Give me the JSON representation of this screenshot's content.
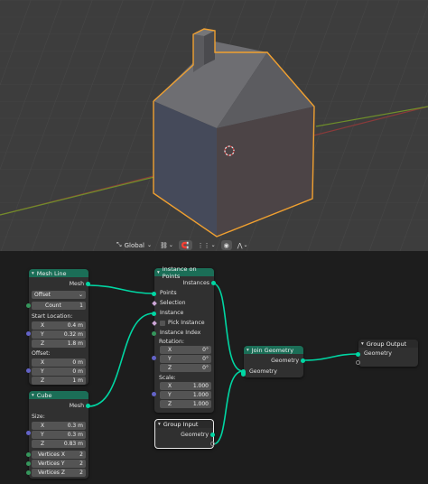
{
  "viewport": {
    "header": {
      "orientation": "Global"
    }
  },
  "nodes": {
    "mesh_line": {
      "title": "Mesh Line",
      "mesh_out": "Mesh",
      "mode": "Offset",
      "count_label": "Count",
      "count_value": "1",
      "start_label": "Start Location:",
      "start": [
        {
          "axis": "X",
          "value": "0.4 m"
        },
        {
          "axis": "Y",
          "value": "0.32 m"
        },
        {
          "axis": "Z",
          "value": "1.8 m"
        }
      ],
      "offset_label": "Offset:",
      "offset": [
        {
          "axis": "X",
          "value": "0 m"
        },
        {
          "axis": "Y",
          "value": "0 m"
        },
        {
          "axis": "Z",
          "value": "1 m"
        }
      ]
    },
    "cube": {
      "title": "Cube",
      "mesh_out": "Mesh",
      "size_label": "Size:",
      "size": [
        {
          "axis": "X",
          "value": "0.3 m"
        },
        {
          "axis": "Y",
          "value": "0.3 m"
        },
        {
          "axis": "Z",
          "value": "0.83 m"
        }
      ],
      "vertices": [
        {
          "label": "Vertices X",
          "value": "2"
        },
        {
          "label": "Vertices Y",
          "value": "2"
        },
        {
          "label": "Vertices Z",
          "value": "2"
        }
      ]
    },
    "instance_on_points": {
      "title": "Instance on Points",
      "instances_out": "Instances",
      "points": "Points",
      "selection": "Selection",
      "instance": "Instance",
      "pick_instance": "Pick Instance",
      "instance_index": "Instance Index",
      "rotation_label": "Rotation:",
      "rotation": [
        {
          "axis": "X",
          "value": "0°"
        },
        {
          "axis": "Y",
          "value": "0°"
        },
        {
          "axis": "Z",
          "value": "0°"
        }
      ],
      "scale_label": "Scale:",
      "scale": [
        {
          "axis": "X",
          "value": "1.000"
        },
        {
          "axis": "Y",
          "value": "1.000"
        },
        {
          "axis": "Z",
          "value": "1.000"
        }
      ]
    },
    "join_geometry": {
      "title": "Join Geometry",
      "geometry_out": "Geometry",
      "geometry_in": "Geometry"
    },
    "group_input": {
      "title": "Group Input",
      "geometry_out": "Geometry"
    },
    "group_output": {
      "title": "Group Output",
      "geometry_in": "Geometry"
    }
  },
  "colors": {
    "node_header_geometry": "#1b6e57",
    "link_geometry": "#00d6a3",
    "selection_outline": "#f0a030"
  }
}
